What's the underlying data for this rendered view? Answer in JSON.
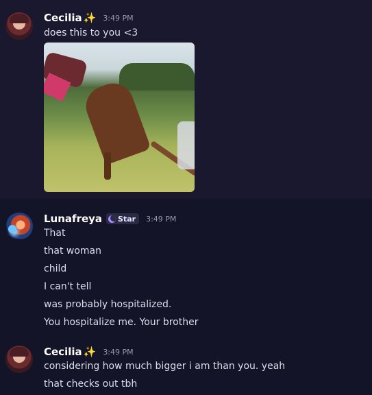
{
  "messages": [
    {
      "username": "Cecilia",
      "sparkle": "✨",
      "time": "3:49 PM",
      "lines": [
        "does this to you <3"
      ],
      "attachment": "gif"
    },
    {
      "username": "Lunafreya",
      "badge": "Star",
      "time": "3:49 PM",
      "lines": [
        "That",
        "that woman",
        "child",
        "I can't tell",
        "was probably hospitalized.",
        "You hospitalize me. Your brother"
      ]
    },
    {
      "username": "Cecilia",
      "sparkle": "✨",
      "time": "3:49 PM",
      "lines": [
        "considering how much bigger i am than you. yeah",
        "that checks out tbh"
      ]
    }
  ]
}
